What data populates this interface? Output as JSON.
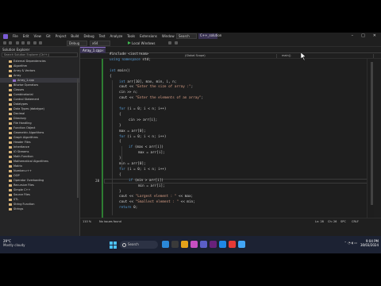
{
  "menu": {
    "items": [
      "File",
      "Edit",
      "View",
      "Git",
      "Project",
      "Build",
      "Debug",
      "Test",
      "Analyze",
      "Tools",
      "Extensions",
      "Window",
      "Help"
    ],
    "search_label": "Search",
    "solution_name": "C++_solution"
  },
  "toolbar": {
    "config": "Debug",
    "platform": "x64",
    "run_label": "Local Windows Debugger"
  },
  "solution_explorer": {
    "title": "Solution Explorer",
    "search_placeholder": "Search Solution Explorer (Ctrl+;)",
    "items": [
      {
        "label": "External Dependencies",
        "depth": 1,
        "type": "folder"
      },
      {
        "label": "Algorithm",
        "depth": 1,
        "type": "folder"
      },
      {
        "label": "Array & Vectors",
        "depth": 1,
        "type": "folder"
      },
      {
        "label": "Array",
        "depth": 1,
        "type": "folder"
      },
      {
        "label": "Array_1.cpp",
        "depth": 2,
        "type": "cpp",
        "selected": true
      },
      {
        "label": "Bitwise Operators",
        "depth": 1,
        "type": "folder"
      },
      {
        "label": "Classes",
        "depth": 1,
        "type": "folder"
      },
      {
        "label": "Combinatorial",
        "depth": 1,
        "type": "folder"
      },
      {
        "label": "Control Statement",
        "depth": 1,
        "type": "folder"
      },
      {
        "label": "Datatypes",
        "depth": 1,
        "type": "folder"
      },
      {
        "label": "Data Types (datatype)",
        "depth": 1,
        "type": "folder"
      },
      {
        "label": "Decimal",
        "depth": 1,
        "type": "folder"
      },
      {
        "label": "Directory",
        "depth": 1,
        "type": "folder"
      },
      {
        "label": "File Handling",
        "depth": 1,
        "type": "folder"
      },
      {
        "label": "Function Object",
        "depth": 1,
        "type": "folder"
      },
      {
        "label": "Geometric Algorithms",
        "depth": 1,
        "type": "folder"
      },
      {
        "label": "Graph Algorithms",
        "depth": 1,
        "type": "folder"
      },
      {
        "label": "Header Files",
        "depth": 1,
        "type": "folder"
      },
      {
        "label": "Inheritance",
        "depth": 1,
        "type": "folder"
      },
      {
        "label": "IO Streams",
        "depth": 1,
        "type": "folder"
      },
      {
        "label": "Math Function",
        "depth": 1,
        "type": "folder"
      },
      {
        "label": "Mathematical Algorithms",
        "depth": 1,
        "type": "folder"
      },
      {
        "label": "Matrix",
        "depth": 1,
        "type": "folder"
      },
      {
        "label": "Number-c++",
        "depth": 1,
        "type": "folder"
      },
      {
        "label": "OOP",
        "depth": 1,
        "type": "folder"
      },
      {
        "label": "Operator Overloading",
        "depth": 1,
        "type": "folder"
      },
      {
        "label": "Recursive Files",
        "depth": 1,
        "type": "folder"
      },
      {
        "label": "Simple C++",
        "depth": 1,
        "type": "folder"
      },
      {
        "label": "Source Files",
        "depth": 1,
        "type": "folder"
      },
      {
        "label": "STL",
        "depth": 1,
        "type": "folder"
      },
      {
        "label": "String Function",
        "depth": 1,
        "type": "folder"
      },
      {
        "label": "Strings",
        "depth": 1,
        "type": "folder"
      }
    ]
  },
  "editor": {
    "tab_label": "Array_1.cpp",
    "nav": [
      "(Global Scope)",
      "main()"
    ],
    "current_line_number": "28",
    "lines": [
      {
        "text": "#include <iostream>",
        "indent": 0
      },
      {
        "text": "using namespace std;",
        "indent": 0
      },
      {
        "text": "",
        "indent": 0
      },
      {
        "text": "int main()",
        "indent": 0
      },
      {
        "text": "{",
        "indent": 0
      },
      {
        "text": "int arr[10], max, min, i, n;",
        "indent": 1
      },
      {
        "text": "cout << \"Enter the size of array :\";",
        "indent": 1
      },
      {
        "text": "cin >> n;",
        "indent": 1
      },
      {
        "text": "cout << \"Enter the elements of an array\";",
        "indent": 1
      },
      {
        "text": "",
        "indent": 0
      },
      {
        "text": "for (i = 0; i < n; i++)",
        "indent": 1
      },
      {
        "text": "{",
        "indent": 1
      },
      {
        "text": "cin >> arr[i];",
        "indent": 2
      },
      {
        "text": "}",
        "indent": 1
      },
      {
        "text": "max = arr[0];",
        "indent": 1
      },
      {
        "text": "for (i = 0; i < n; i++)",
        "indent": 1
      },
      {
        "text": "{",
        "indent": 1
      },
      {
        "text": "if (max < arr[i])",
        "indent": 2
      },
      {
        "text": "max = arr[i];",
        "indent": 3
      },
      {
        "text": "}",
        "indent": 1
      },
      {
        "text": "min = arr[0];",
        "indent": 1
      },
      {
        "text": "for (i = 0; i < n; i++)",
        "indent": 1
      },
      {
        "text": "{",
        "indent": 1
      },
      {
        "text": "if (min > arr[i])",
        "indent": 2
      },
      {
        "text": "min = arr[i];",
        "indent": 3
      },
      {
        "text": "}",
        "indent": 1
      },
      {
        "text": "cout << \"Largest element : \" << max;",
        "indent": 1
      },
      {
        "text": "cout << \"Smallest element : \" << min;",
        "indent": 1
      },
      {
        "text": "return 0;",
        "indent": 1
      }
    ]
  },
  "status": {
    "zoom": "110 %",
    "issues": "No issues found",
    "position": "Ln: 28",
    "col": "Ch: 26",
    "spc": "SPC",
    "crlf": "CRLF"
  },
  "bottom_tabs": [
    "Solution Explorer",
    "Git Changes"
  ],
  "output_tabs": [
    "Error List",
    "Output"
  ],
  "taskbar": {
    "temperature": "29°C",
    "weather": "Mostly cloudy",
    "search_label": "Search",
    "time": "9:04 PM",
    "date": "30/03/2024"
  },
  "colors": {
    "keyword": "#569cd6",
    "string": "#d69d85",
    "accent": "#8e6dc9"
  }
}
